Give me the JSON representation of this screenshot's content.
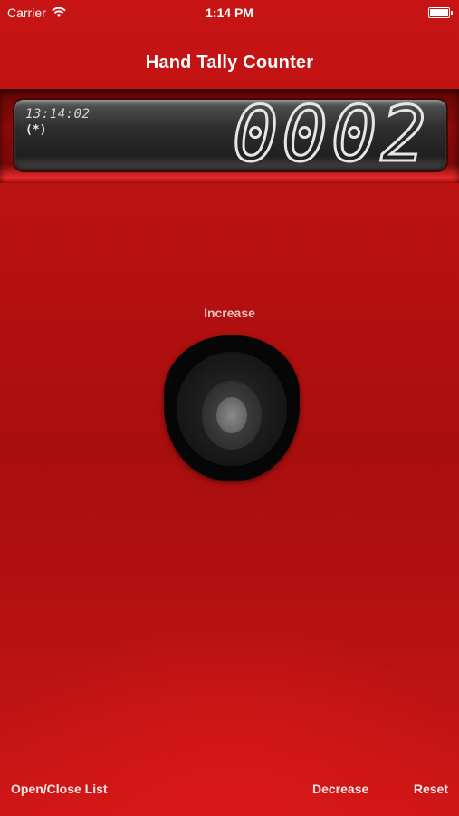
{
  "status_bar": {
    "carrier": "Carrier",
    "time": "1:14 PM"
  },
  "navigation": {
    "title": "Hand Tally Counter"
  },
  "display": {
    "timestamp": "13:14:02",
    "indicator": "(*)",
    "count": "0002"
  },
  "main": {
    "increase_label": "Increase"
  },
  "bottom_bar": {
    "open_close_list": "Open/Close List",
    "decrease": "Decrease",
    "reset": "Reset"
  },
  "colors": {
    "background": "#b51010",
    "lcd_background": "#2a2a2a",
    "lcd_digits": "#e6e6e6",
    "button": "#060606"
  }
}
